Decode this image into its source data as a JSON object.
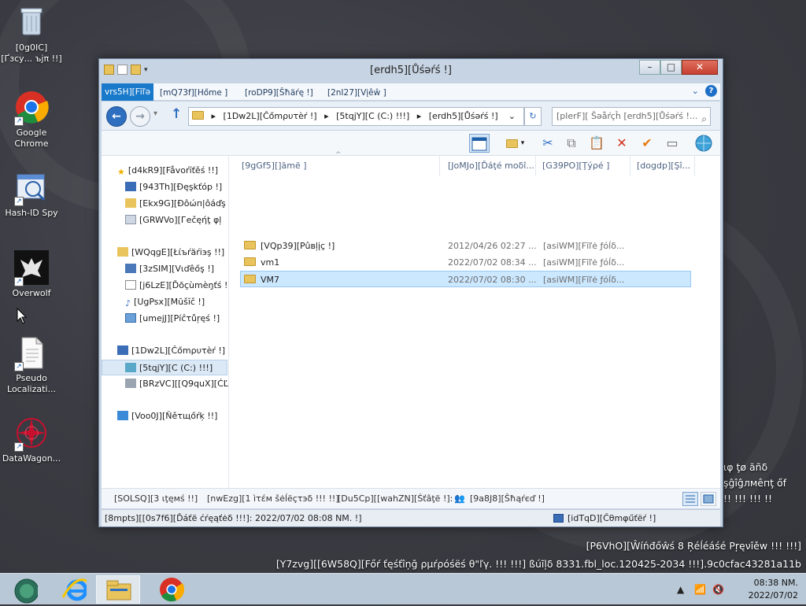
{
  "desktop": {
    "icons": [
      {
        "label": "[0g0IC][Ґзϲу... ъјπ !!]"
      },
      {
        "label": "Google Chrome"
      },
      {
        "label": "Hash-ID Spy"
      },
      {
        "label": "Overwolf"
      },
      {
        "label": "Pseudo Localizati..."
      },
      {
        "label": "DataWagon..."
      }
    ],
    "side_text": [
      "ιφ ţø ăñδ",
      "şĝîĝлмêпţ őf",
      "!! !!! !!! !!"
    ],
    "build_line1": "[P6VhO][Ŵíńđőŵś 8 Ŗéĺéáśé Ρŗęνîěw !!! !!!]",
    "build_line2": "[Y7zvg][[6W58Q][Főŕ ťęśťîņğ ρµŕρóśëś θ\"ľγ. !!! !!!] ßúĩļδ 8331.fbl_loc.120425-2034 !!!].9c0cfac43281a11b"
  },
  "window": {
    "title": "[erdh5][Ůśəŕś !]",
    "buttons": {
      "minimize": "–",
      "maximize": "□",
      "close": "✕"
    },
    "ribbon": {
      "file_tab": "vrs5H][Fĩľə",
      "tabs": [
        "[mQ73f][Hőme ]",
        "[roDP9][Ŝħäŕę !]",
        "[2nI27][Vįêŵ ]"
      ],
      "help": "?"
    },
    "address": {
      "segments": [
        "[1Dw2L][Ĉőmρυτèŕ !]",
        "[5tqjY][C (C:) !!!]",
        "[erdh5][Ůśəŕś !]"
      ],
      "search_placeholder": "[plerF][ Šəåŕçĥ [erdh5][Ůśəŕś !..."
    },
    "columns": [
      "[9gGf5][]āmë ]",
      "[JoMJo][Ďáţé moδî...",
      "[G39PO][Ţýρé ]",
      "[dogdp][Şî..."
    ],
    "files": [
      {
        "name": "[VQp39][Pûвļįç !]",
        "date": "2012/04/26 02:27 ...",
        "type": "[asiWM][Fĩľė ƒóĺδ..."
      },
      {
        "name": "vm1",
        "date": "2022/07/02 08:34 ...",
        "type": "[asiWM][Fĩľė ƒóĺδ..."
      },
      {
        "name": "VM7",
        "date": "2022/07/02 08:30 ...",
        "type": "[asiWM][Fĩľė ƒóĺδ...",
        "selected": true
      }
    ],
    "nav": {
      "favorites": "[d4kR9][Fåvoŕĭťěś !!]",
      "favorites_items": [
        "[943Th][Ðęşkťóp !]",
        "[Ekx9G][Ðôώп|ôáďş",
        "[GRWVo][Гečęήţ φļ"
      ],
      "libraries": "[WQqgE][Łίъŕäŕіэş !!]",
      "libraries_items": [
        "[3zSIM][Vιďêőş !]",
        "[j6LzE][Ďõçùmèŋťś !",
        "[UgPsx][Mūšĭč !]",
        "[umejJ][Píĉτůŗęś !]"
      ],
      "computer": "[1Dw2L][Ĉőmρυτèŕ !]",
      "computer_items": [
        "[5tqjY][C (C:) !!!]",
        "[BRzVC][[Q9quX][ĆĽ"
      ],
      "network": "[Voo0J][Ňěτщőŕķ !!]"
    },
    "status": {
      "count": "[SOLSQ][3 ιţęмś !!]",
      "selected": "[nwEzg][1 ìτέм šėĺёçτэδ !!! !!]",
      "state": "[Du5Cp][[wahZN][Śťâţë !]: ]",
      "shared": "[9a8J8][Ŝħąŕєď !]"
    },
    "details": {
      "date_created": "[8mpts][[0s7f6][Ďáťë ćŕęąťėδ !!!]: 2022/07/02 08:08 NM. !]",
      "location": "[idTqD][Ĉθmφűťёŕ !]"
    }
  },
  "taskbar": {
    "time": "08:38 NM.",
    "date": "2022/07/02"
  },
  "colors": {
    "accent": "#1979ca",
    "selection": "#cce8ff",
    "desktop_bg": "#3b3c43"
  }
}
